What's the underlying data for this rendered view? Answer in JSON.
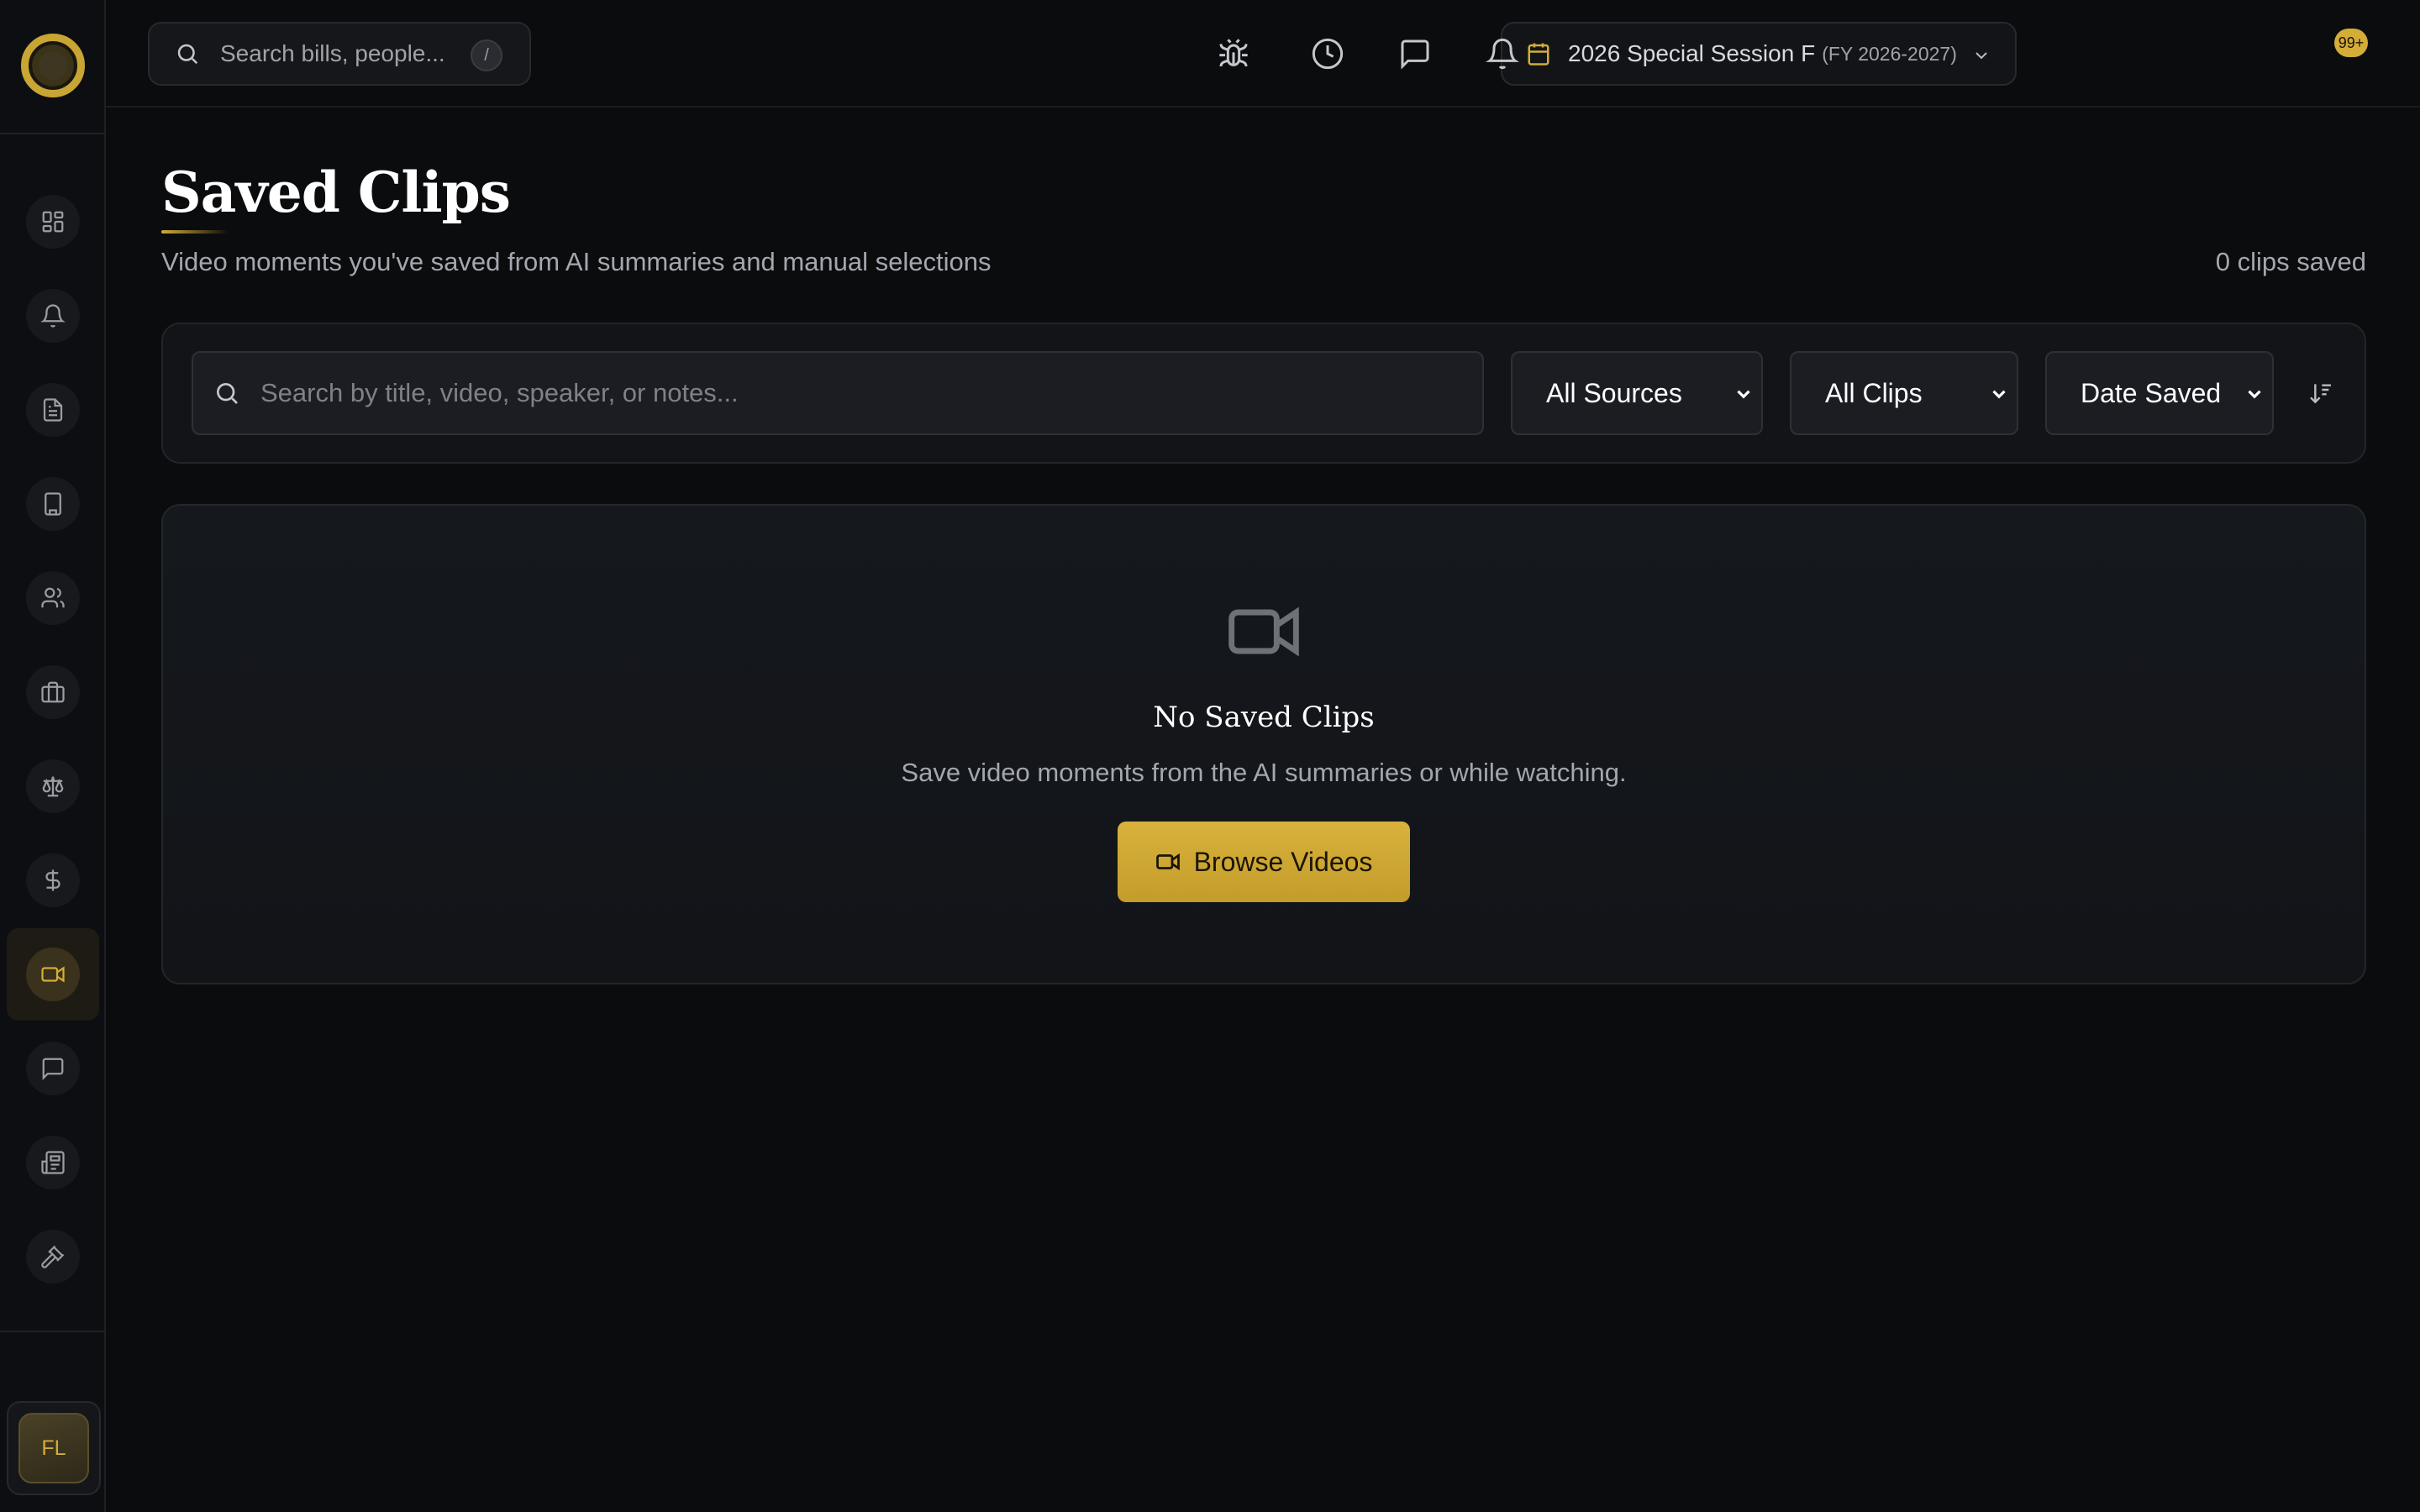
{
  "topbar": {
    "search_placeholder": "Search bills, people...",
    "shortcut_key": "/",
    "session_name": "2026 Special Session F",
    "session_fy": "(FY 2026-2027)",
    "notification_badge": "99+"
  },
  "sidebar": {
    "items": [
      {
        "icon": "dashboard-icon"
      },
      {
        "icon": "bell-icon"
      },
      {
        "icon": "document-icon"
      },
      {
        "icon": "building-icon"
      },
      {
        "icon": "users-icon"
      },
      {
        "icon": "briefcase-icon"
      },
      {
        "icon": "scale-icon"
      },
      {
        "icon": "dollar-icon"
      },
      {
        "icon": "video-icon",
        "active": true
      },
      {
        "icon": "message-icon"
      },
      {
        "icon": "newspaper-icon"
      },
      {
        "icon": "gavel-icon"
      }
    ],
    "user_initials": "FL"
  },
  "page": {
    "title": "Saved Clips",
    "subtitle": "Video moments you've saved from AI summaries and manual selections",
    "count": "0 clips saved"
  },
  "filters": {
    "search_placeholder": "Search by title, video, speaker, or notes...",
    "source": "All Sources",
    "clips": "All Clips",
    "sort": "Date Saved"
  },
  "empty_state": {
    "title": "No Saved Clips",
    "text": "Save video moments from the AI summaries or while watching.",
    "button_label": "Browse Videos"
  },
  "colors": {
    "accent": "#d4ad38",
    "background": "#0b0c0e"
  }
}
